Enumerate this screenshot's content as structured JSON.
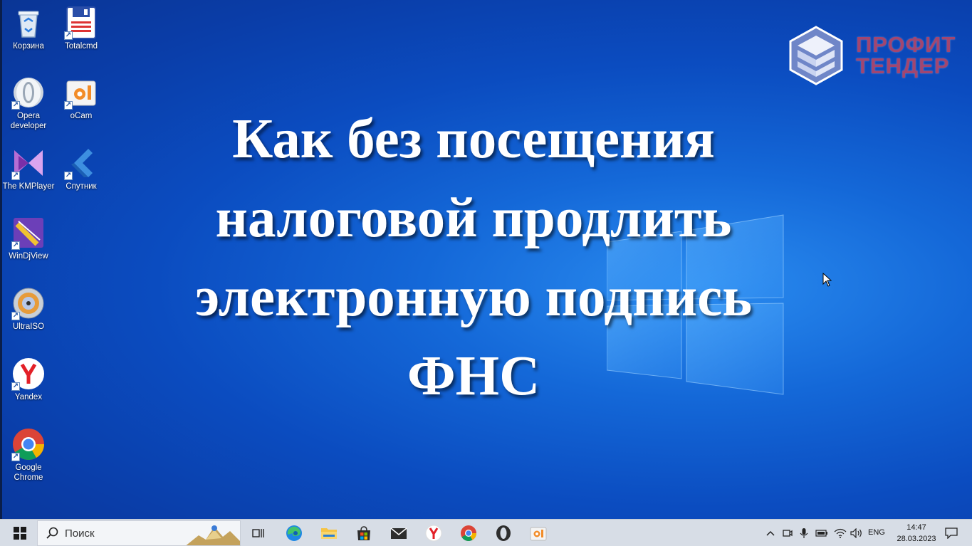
{
  "desktop": {
    "icons": [
      {
        "label": "Корзина",
        "icon": "recycle-bin-icon"
      },
      {
        "label": "Totalcmd",
        "icon": "total-commander-icon"
      },
      {
        "label": "Opera developer",
        "icon": "opera-icon"
      },
      {
        "label": "oCam",
        "icon": "ocam-icon"
      },
      {
        "label": "The KMPlayer",
        "icon": "kmplayer-icon"
      },
      {
        "label": "Спутник",
        "icon": "sputnik-icon"
      },
      {
        "label": "WinDjView",
        "icon": "windjview-icon"
      },
      {
        "label": "UltraISO",
        "icon": "ultraiso-icon"
      },
      {
        "label": "Yandex",
        "icon": "yandex-icon"
      },
      {
        "label": "Google Chrome",
        "icon": "chrome-icon"
      }
    ]
  },
  "overlay": {
    "title_lines": [
      "Как без посещения",
      "налоговой продлить",
      "электронную подпись",
      "ФНС"
    ]
  },
  "brand": {
    "line1": "ПРОФИТ",
    "line2": "ТЕНДЕР",
    "color": "#a24670"
  },
  "taskbar": {
    "search_placeholder": "Поиск",
    "pinned": [
      "task-view-icon",
      "edge-icon",
      "file-explorer-icon",
      "store-icon",
      "mail-icon",
      "yandex-icon",
      "chrome-icon",
      "opera-icon",
      "ocam-icon"
    ],
    "tray": {
      "lang": "ENG",
      "time": "14:47",
      "date": "28.03.2023"
    }
  },
  "colors": {
    "desktop_blue": "#0b4cc0",
    "taskbar": "#d7dde6",
    "title": "#ffffff"
  }
}
